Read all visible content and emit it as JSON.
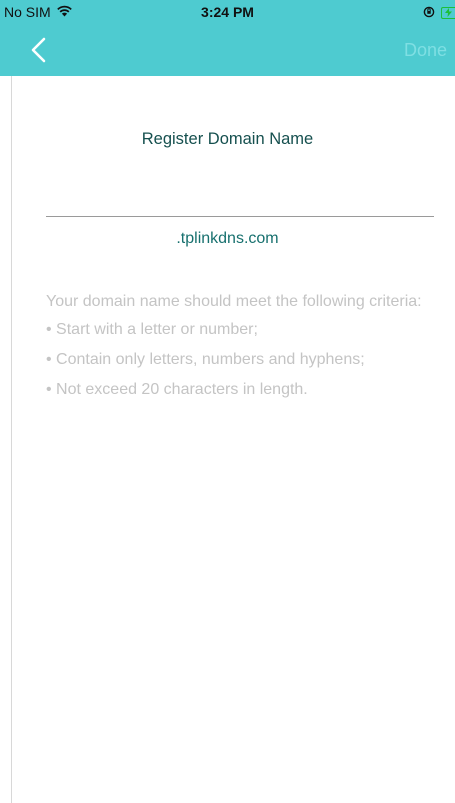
{
  "status_bar": {
    "carrier": "No SIM",
    "time": "3:24 PM"
  },
  "nav": {
    "done_label": "Done"
  },
  "main": {
    "title": "Register Domain Name",
    "domain_value": "",
    "domain_suffix": ".tplinkdns.com",
    "criteria_intro": "Your domain name should meet the following criteria:",
    "criteria_items": [
      "• Start with a letter or number;",
      "• Contain only letters, numbers and hyphens;",
      "• Not exceed 20 characters in length."
    ]
  },
  "colors": {
    "nav_background": "#4ecbd0",
    "title_text": "#16504f",
    "suffix_text": "#17706e",
    "hint_text": "#c4c4c4",
    "done_disabled": "#7fdfe3"
  }
}
